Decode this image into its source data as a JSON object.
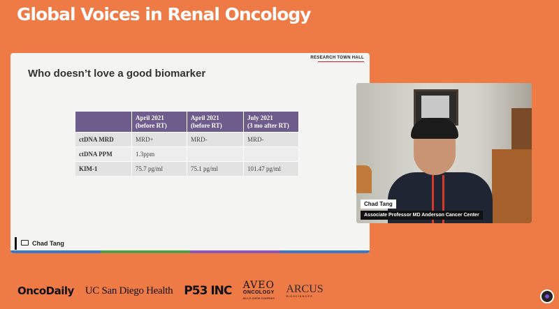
{
  "page_title": "Global Voices in Renal Oncology",
  "slide": {
    "brand": "RESEARCH TOWN HALL",
    "heading": "Who doesn’t love a good biomarker",
    "table": {
      "headers": [
        "",
        "April 2021\n(before RT)",
        "April 2021\n(before RT)",
        "July 2021\n(3 mo after RT)"
      ],
      "rows": [
        [
          "ctDNA MRD",
          "MRD+",
          "MRD-",
          "MRD-"
        ],
        [
          "ctDNA PPM",
          "1.3ppm",
          "",
          ""
        ],
        [
          "KIM-1",
          "75.7 pg/ml",
          "75.1 pg/ml",
          "101.47 pg/ml"
        ]
      ]
    },
    "speaker_label": "Chad Tang",
    "stripe_colors": [
      "#3a78c7",
      "#4fa046",
      "#8a56b8",
      "#3a78c7"
    ]
  },
  "video": {
    "name": "Chad Tang",
    "title": "Associate Professor MD Anderson Cancer Center"
  },
  "sponsors": {
    "oncodaily": "OncoDaily",
    "ucsd": "UC San Diego Health",
    "p53": "P53 INC",
    "aveo": {
      "name": "AVEO",
      "sub": "ONCOLOGY",
      "tag": "AN LG CHEM COMPANY"
    },
    "arcus": {
      "name": "ARCUS",
      "sub": "BIOSCIENCES"
    }
  },
  "colors": {
    "background": "#ee7a45",
    "table_header": "#6d5c8c"
  }
}
